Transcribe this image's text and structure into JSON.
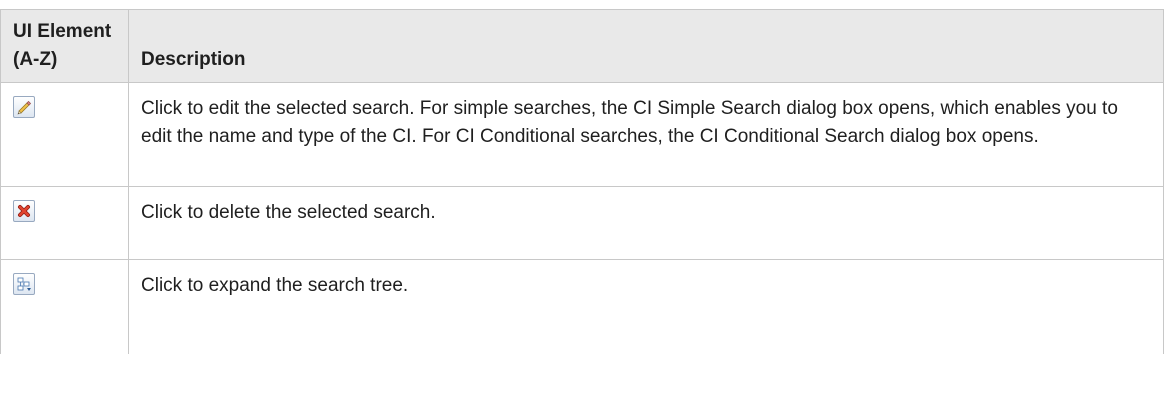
{
  "table": {
    "headers": {
      "ui_element": "UI Element (A-Z)",
      "description": "Description"
    },
    "rows": [
      {
        "icon": "pencil-edit-icon",
        "description": "Click to edit the selected search. For simple searches, the CI Simple Search dialog box opens, which enables you to edit the name and type of the CI. For CI Conditional searches, the CI Conditional Search dialog box opens."
      },
      {
        "icon": "red-x-delete-icon",
        "description": "Click to delete the selected search."
      },
      {
        "icon": "expand-tree-icon",
        "description": "Click to expand the search tree."
      }
    ]
  },
  "colors": {
    "header_background": "#e9e9e9",
    "border": "#c8c8c8",
    "delete_red": "#d8352a"
  }
}
